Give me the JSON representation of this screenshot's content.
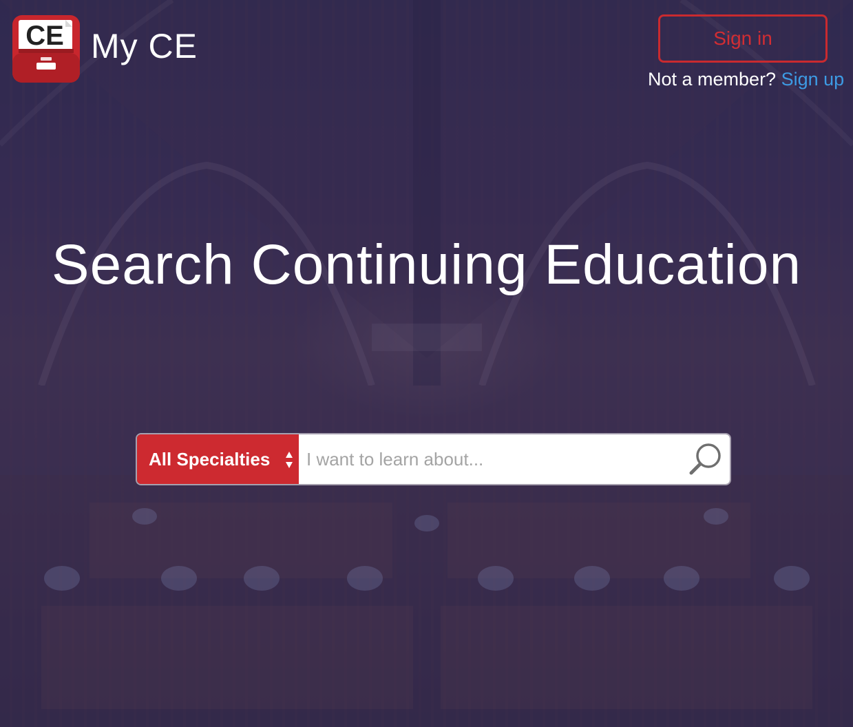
{
  "header": {
    "logo_text": "CE",
    "brand_name": "My CE",
    "signin_label": "Sign in",
    "member_prompt": "Not a member?",
    "signup_label": "Sign up"
  },
  "hero": {
    "headline": "Search Continuing Education"
  },
  "search": {
    "specialty_selected": "All Specialties",
    "placeholder": "I want to learn about..."
  },
  "colors": {
    "accent_red": "#cd2a30",
    "link_blue": "#3d9be4",
    "overlay": "#26285c"
  },
  "icons": {
    "logo": "ce-cabinet-logo-icon",
    "search": "search-icon",
    "select": "select-arrows-icon"
  }
}
